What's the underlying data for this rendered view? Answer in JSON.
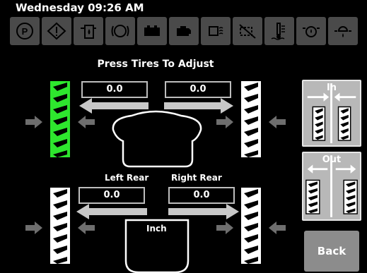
{
  "status_bar": {
    "datetime": "Wednesday 09:26 AM"
  },
  "indicator_icons": [
    {
      "name": "parking-brake-icon"
    },
    {
      "name": "warning-icon"
    },
    {
      "name": "fuel-filter-icon"
    },
    {
      "name": "brake-system-icon"
    },
    {
      "name": "battery-icon"
    },
    {
      "name": "engine-icon"
    },
    {
      "name": "glow-plug-icon"
    },
    {
      "name": "dpf-regen-icon"
    },
    {
      "name": "coolant-temperature-icon"
    },
    {
      "name": "hydraulic-oil-icon"
    },
    {
      "name": "oil-pressure-icon"
    }
  ],
  "title": "Press Tires To Adjust",
  "front": {
    "left_value": "0.0",
    "right_value": "0.0"
  },
  "rear": {
    "left_label": "Left Rear",
    "right_label": "Right Rear",
    "left_value": "0.0",
    "right_value": "0.0"
  },
  "units_label": "Inch",
  "buttons": {
    "in": "In",
    "out": "Out",
    "back": "Back"
  },
  "tires": {
    "front_left": "selected",
    "front_right": "unselected",
    "rear_left": "unselected",
    "rear_right": "unselected"
  },
  "colors": {
    "selected_tire": "#2ee62e",
    "tire": "#ffffff",
    "button_gray": "#b8b8b8",
    "back_gray": "#8c8c8c"
  }
}
